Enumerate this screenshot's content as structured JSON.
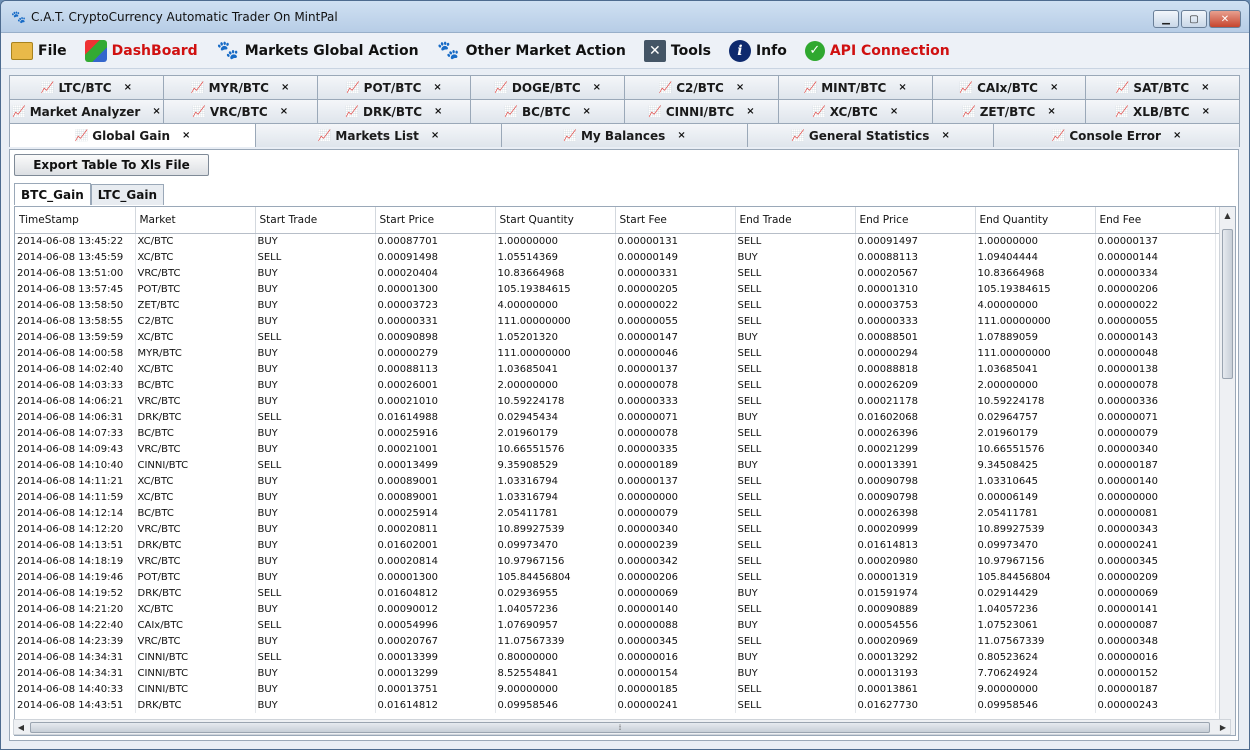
{
  "window": {
    "title": "C.A.T. CryptoCurrency Automatic Trader On MintPal"
  },
  "menu": [
    {
      "label": "File",
      "icon": "folder-icon",
      "red": false
    },
    {
      "label": "DashBoard",
      "icon": "dashboard-icon",
      "red": true
    },
    {
      "label": "Markets Global Action",
      "icon": "paw-icon",
      "red": false
    },
    {
      "label": "Other Market Action",
      "icon": "paw-icon",
      "red": false
    },
    {
      "label": "Tools",
      "icon": "tools-icon",
      "red": false
    },
    {
      "label": "Info",
      "icon": "info-icon",
      "red": false
    },
    {
      "label": "API Connection",
      "icon": "check-icon",
      "red": true
    }
  ],
  "tabs": {
    "row1": [
      "LTC/BTC",
      "MYR/BTC",
      "POT/BTC",
      "DOGE/BTC",
      "C2/BTC",
      "MINT/BTC",
      "CAIx/BTC",
      "SAT/BTC"
    ],
    "row2": [
      "Market Analyzer",
      "VRC/BTC",
      "DRK/BTC",
      "BC/BTC",
      "CINNI/BTC",
      "XC/BTC",
      "ZET/BTC",
      "XLB/BTC"
    ],
    "row3": [
      "Global Gain",
      "Markets List",
      "My Balances",
      "General Statistics",
      "Console Error"
    ],
    "close": "×"
  },
  "export_button": "Export Table To Xls File",
  "subtabs": [
    "BTC_Gain",
    "LTC_Gain"
  ],
  "table": {
    "columns": [
      "TimeStamp",
      "Market",
      "Start Trade",
      "Start Price",
      "Start Quantity",
      "Start Fee",
      "End Trade",
      "End Price",
      "End Quantity",
      "End Fee"
    ],
    "rows": [
      [
        "2014-06-08 13:45:22",
        "XC/BTC",
        "BUY",
        "0.00087701",
        "1.00000000",
        "0.00000131",
        "SELL",
        "0.00091497",
        "1.00000000",
        "0.00000137"
      ],
      [
        "2014-06-08 13:45:59",
        "XC/BTC",
        "SELL",
        "0.00091498",
        "1.05514369",
        "0.00000149",
        "BUY",
        "0.00088113",
        "1.09404444",
        "0.00000144"
      ],
      [
        "2014-06-08 13:51:00",
        "VRC/BTC",
        "BUY",
        "0.00020404",
        "10.83664968",
        "0.00000331",
        "SELL",
        "0.00020567",
        "10.83664968",
        "0.00000334"
      ],
      [
        "2014-06-08 13:57:45",
        "POT/BTC",
        "BUY",
        "0.00001300",
        "105.19384615",
        "0.00000205",
        "SELL",
        "0.00001310",
        "105.19384615",
        "0.00000206"
      ],
      [
        "2014-06-08 13:58:50",
        "ZET/BTC",
        "BUY",
        "0.00003723",
        "4.00000000",
        "0.00000022",
        "SELL",
        "0.00003753",
        "4.00000000",
        "0.00000022"
      ],
      [
        "2014-06-08 13:58:55",
        "C2/BTC",
        "BUY",
        "0.00000331",
        "111.00000000",
        "0.00000055",
        "SELL",
        "0.00000333",
        "111.00000000",
        "0.00000055"
      ],
      [
        "2014-06-08 13:59:59",
        "XC/BTC",
        "SELL",
        "0.00090898",
        "1.05201320",
        "0.00000147",
        "BUY",
        "0.00088501",
        "1.07889059",
        "0.00000143"
      ],
      [
        "2014-06-08 14:00:58",
        "MYR/BTC",
        "BUY",
        "0.00000279",
        "111.00000000",
        "0.00000046",
        "SELL",
        "0.00000294",
        "111.00000000",
        "0.00000048"
      ],
      [
        "2014-06-08 14:02:40",
        "XC/BTC",
        "BUY",
        "0.00088113",
        "1.03685041",
        "0.00000137",
        "SELL",
        "0.00088818",
        "1.03685041",
        "0.00000138"
      ],
      [
        "2014-06-08 14:03:33",
        "BC/BTC",
        "BUY",
        "0.00026001",
        "2.00000000",
        "0.00000078",
        "SELL",
        "0.00026209",
        "2.00000000",
        "0.00000078"
      ],
      [
        "2014-06-08 14:06:21",
        "VRC/BTC",
        "BUY",
        "0.00021010",
        "10.59224178",
        "0.00000333",
        "SELL",
        "0.00021178",
        "10.59224178",
        "0.00000336"
      ],
      [
        "2014-06-08 14:06:31",
        "DRK/BTC",
        "SELL",
        "0.01614988",
        "0.02945434",
        "0.00000071",
        "BUY",
        "0.01602068",
        "0.02964757",
        "0.00000071"
      ],
      [
        "2014-06-08 14:07:33",
        "BC/BTC",
        "BUY",
        "0.00025916",
        "2.01960179",
        "0.00000078",
        "SELL",
        "0.00026396",
        "2.01960179",
        "0.00000079"
      ],
      [
        "2014-06-08 14:09:43",
        "VRC/BTC",
        "BUY",
        "0.00021001",
        "10.66551576",
        "0.00000335",
        "SELL",
        "0.00021299",
        "10.66551576",
        "0.00000340"
      ],
      [
        "2014-06-08 14:10:40",
        "CINNI/BTC",
        "SELL",
        "0.00013499",
        "9.35908529",
        "0.00000189",
        "BUY",
        "0.00013391",
        "9.34508425",
        "0.00000187"
      ],
      [
        "2014-06-08 14:11:21",
        "XC/BTC",
        "BUY",
        "0.00089001",
        "1.03316794",
        "0.00000137",
        "SELL",
        "0.00090798",
        "1.03310645",
        "0.00000140"
      ],
      [
        "2014-06-08 14:11:59",
        "XC/BTC",
        "BUY",
        "0.00089001",
        "1.03316794",
        "0.00000000",
        "SELL",
        "0.00090798",
        "0.00006149",
        "0.00000000"
      ],
      [
        "2014-06-08 14:12:14",
        "BC/BTC",
        "BUY",
        "0.00025914",
        "2.05411781",
        "0.00000079",
        "SELL",
        "0.00026398",
        "2.05411781",
        "0.00000081"
      ],
      [
        "2014-06-08 14:12:20",
        "VRC/BTC",
        "BUY",
        "0.00020811",
        "10.89927539",
        "0.00000340",
        "SELL",
        "0.00020999",
        "10.89927539",
        "0.00000343"
      ],
      [
        "2014-06-08 14:13:51",
        "DRK/BTC",
        "BUY",
        "0.01602001",
        "0.09973470",
        "0.00000239",
        "SELL",
        "0.01614813",
        "0.09973470",
        "0.00000241"
      ],
      [
        "2014-06-08 14:18:19",
        "VRC/BTC",
        "BUY",
        "0.00020814",
        "10.97967156",
        "0.00000342",
        "SELL",
        "0.00020980",
        "10.97967156",
        "0.00000345"
      ],
      [
        "2014-06-08 14:19:46",
        "POT/BTC",
        "BUY",
        "0.00001300",
        "105.84456804",
        "0.00000206",
        "SELL",
        "0.00001319",
        "105.84456804",
        "0.00000209"
      ],
      [
        "2014-06-08 14:19:52",
        "DRK/BTC",
        "SELL",
        "0.01604812",
        "0.02936955",
        "0.00000069",
        "BUY",
        "0.01591974",
        "0.02914429",
        "0.00000069"
      ],
      [
        "2014-06-08 14:21:20",
        "XC/BTC",
        "BUY",
        "0.00090012",
        "1.04057236",
        "0.00000140",
        "SELL",
        "0.00090889",
        "1.04057236",
        "0.00000141"
      ],
      [
        "2014-06-08 14:22:40",
        "CAIx/BTC",
        "SELL",
        "0.00054996",
        "1.07690957",
        "0.00000088",
        "BUY",
        "0.00054556",
        "1.07523061",
        "0.00000087"
      ],
      [
        "2014-06-08 14:23:39",
        "VRC/BTC",
        "BUY",
        "0.00020767",
        "11.07567339",
        "0.00000345",
        "SELL",
        "0.00020969",
        "11.07567339",
        "0.00000348"
      ],
      [
        "2014-06-08 14:34:31",
        "CINNI/BTC",
        "SELL",
        "0.00013399",
        "0.80000000",
        "0.00000016",
        "BUY",
        "0.00013292",
        "0.80523624",
        "0.00000016"
      ],
      [
        "2014-06-08 14:34:31",
        "CINNI/BTC",
        "BUY",
        "0.00013299",
        "8.52554841",
        "0.00000154",
        "BUY",
        "0.00013193",
        "7.70624924",
        "0.00000152"
      ],
      [
        "2014-06-08 14:40:33",
        "CINNI/BTC",
        "BUY",
        "0.00013751",
        "9.00000000",
        "0.00000185",
        "SELL",
        "0.00013861",
        "9.00000000",
        "0.00000187"
      ],
      [
        "2014-06-08 14:43:51",
        "DRK/BTC",
        "BUY",
        "0.01614812",
        "0.09958546",
        "0.00000241",
        "SELL",
        "0.01627730",
        "0.09958546",
        "0.00000243"
      ]
    ]
  }
}
